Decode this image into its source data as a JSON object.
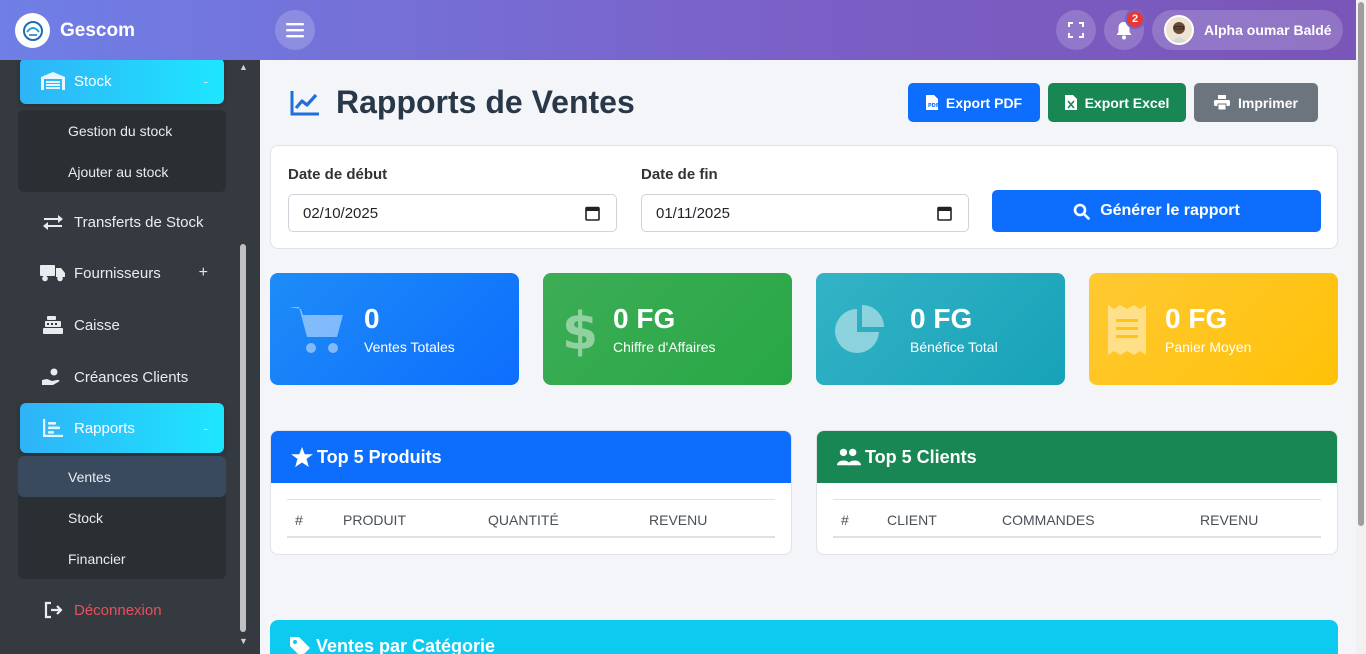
{
  "header": {
    "brand": "Gescom",
    "notification_count": "2",
    "user_name": "Alpha oumar Baldé"
  },
  "sidebar": {
    "stock": {
      "label": "Stock",
      "toggle": "-"
    },
    "stock_sub": [
      "Gestion du stock",
      "Ajouter au stock"
    ],
    "transferts": {
      "label": "Transferts de Stock"
    },
    "fournisseurs": {
      "label": "Fournisseurs",
      "toggle": "+"
    },
    "caisse": {
      "label": "Caisse"
    },
    "creances": {
      "label": "Créances Clients"
    },
    "rapports": {
      "label": "Rapports",
      "toggle": "-"
    },
    "rapports_sub": [
      "Ventes",
      "Stock",
      "Financier"
    ],
    "logout": {
      "label": "Déconnexion"
    }
  },
  "main": {
    "title": "Rapports de Ventes",
    "buttons": {
      "pdf": "Export PDF",
      "excel": "Export Excel",
      "print": "Imprimer"
    },
    "filters": {
      "start_label": "Date de début",
      "start_value": "02/10/2025",
      "end_label": "Date de fin",
      "end_value": "01/11/2025",
      "generate": "Générer le rapport"
    },
    "stats": [
      {
        "value": "0",
        "label": "Ventes Totales",
        "icon": "cart-icon"
      },
      {
        "value": "0 FG",
        "label": "Chiffre d'Affaires",
        "icon": "dollar-icon"
      },
      {
        "value": "0 FG",
        "label": "Bénéfice Total",
        "icon": "pie-chart-icon"
      },
      {
        "value": "0 FG",
        "label": "Panier Moyen",
        "icon": "receipt-icon"
      }
    ],
    "top_products": {
      "title": "Top 5 Produits",
      "columns": [
        "#",
        "PRODUIT",
        "QUANTITÉ",
        "REVENU"
      ]
    },
    "top_clients": {
      "title": "Top 5 Clients",
      "columns": [
        "#",
        "CLIENT",
        "COMMANDES",
        "REVENU"
      ]
    },
    "category": {
      "title": "Ventes par Catégorie"
    }
  },
  "colors": {
    "primary": "#0d6efd",
    "success": "#198754",
    "info": "#0dcaf0",
    "warning": "#ffc107",
    "secondary": "#6c757d",
    "sidebar": "#343a40",
    "danger": "#e8505b"
  }
}
